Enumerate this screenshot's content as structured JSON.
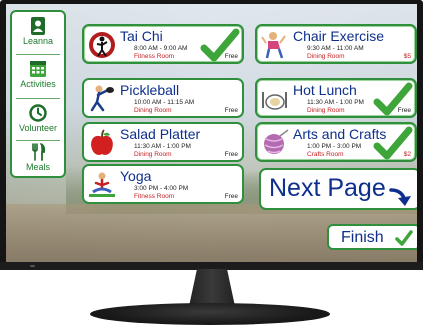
{
  "sidebar": {
    "items": [
      {
        "label": "Leanna",
        "icon": "person-badge-icon"
      },
      {
        "label": "Activities",
        "icon": "calendar-icon"
      },
      {
        "label": "Volunteer",
        "icon": "clock-icon"
      },
      {
        "label": "Meals",
        "icon": "fork-knife-icon"
      }
    ]
  },
  "activities": [
    {
      "name": "Tai Chi",
      "time": "8:00 AM - 9:00 AM",
      "location": "Fitness Room",
      "cost": "Free",
      "selected": true,
      "icon": "tai-chi-icon"
    },
    {
      "name": "Chair Exercise",
      "time": "9:30 AM - 11:00 AM",
      "location": "Dining Room",
      "cost": "$5",
      "selected": true,
      "icon": "chair-exercise-icon"
    },
    {
      "name": "Pickleball",
      "time": "10:00 AM - 11:15 AM",
      "location": "Dining Room",
      "cost": "Free",
      "selected": false,
      "icon": "pickleball-icon"
    },
    {
      "name": "Hot Lunch",
      "time": "11:30 AM - 1:00 PM",
      "location": "Dining Room",
      "cost": "Free",
      "selected": true,
      "icon": "hot-lunch-icon"
    },
    {
      "name": "Salad Platter",
      "time": "11:30 AM - 1:00 PM",
      "location": "Dining Room",
      "cost": "Free",
      "selected": false,
      "icon": "apple-icon"
    },
    {
      "name": "Arts and Crafts",
      "time": "1:00 PM - 3:00 PM",
      "location": "Crafts Room",
      "cost": "$2",
      "selected": true,
      "icon": "yarn-icon"
    },
    {
      "name": "Yoga",
      "time": "3:00 PM - 4:00 PM",
      "location": "Fitness Room",
      "cost": "Free",
      "selected": false,
      "icon": "yoga-icon"
    }
  ],
  "buttons": {
    "next_page": "Next Page",
    "finish": "Finish"
  },
  "colors": {
    "accent": "#2f8f3d",
    "title": "#0e2f8c",
    "location": "#c42020",
    "check": "#3ea53a"
  }
}
